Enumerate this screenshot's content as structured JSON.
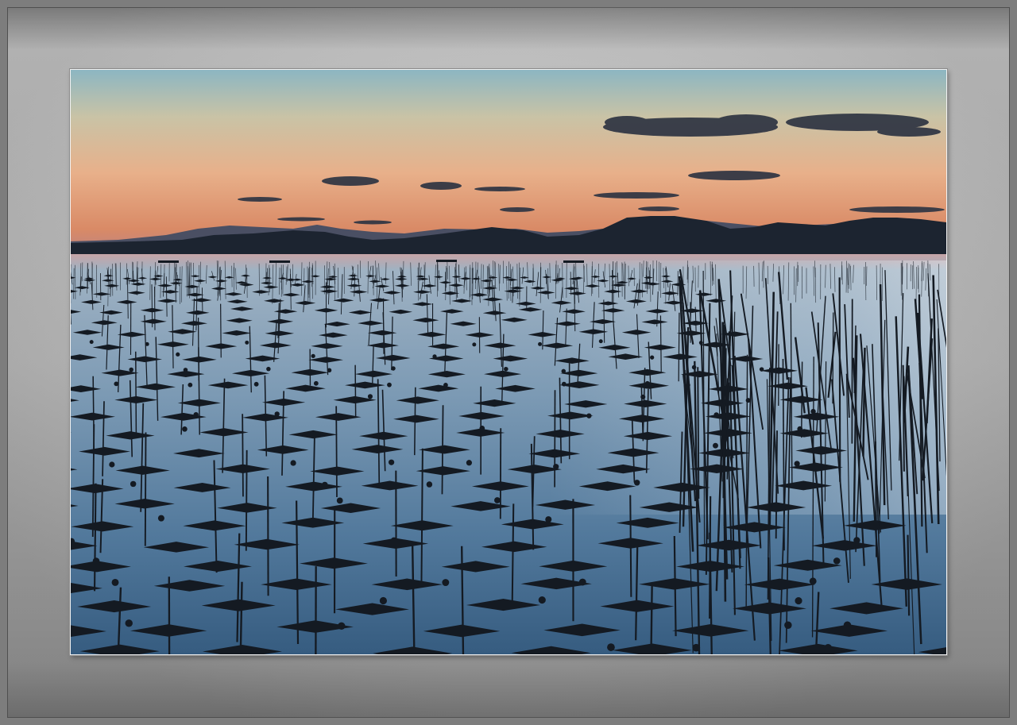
{
  "scene": {
    "description_kind": "seaweed farm at dusk",
    "colors": {
      "sky_top": "#8fb8c4",
      "sky_mid": "#e7b48a",
      "sky_low": "#d98a62",
      "horizon_haze": "#b27a7e",
      "mountains": "#1d2733",
      "water_top": "#a9b9c8",
      "water_bottom": "#3f6a90",
      "silhouette": "#141a22",
      "mat_frame": "#bdbdbd"
    }
  }
}
